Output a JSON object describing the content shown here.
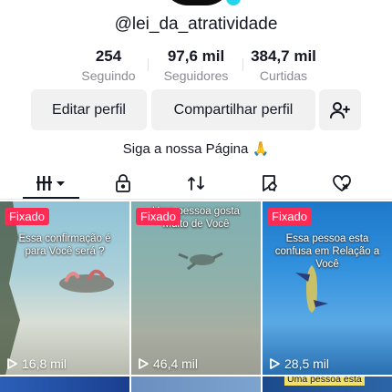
{
  "profile": {
    "username": "@lei_da_atratividade",
    "bio": "Siga a nossa Página 🙏"
  },
  "stats": [
    {
      "value": "254",
      "label": "Seguindo"
    },
    {
      "value": "97,6 mil",
      "label": "Seguidores"
    },
    {
      "value": "384,7 mil",
      "label": "Curtidas"
    }
  ],
  "buttons": {
    "edit": "Editar perfil",
    "share": "Compartilhar perfil"
  },
  "tabs": [
    {
      "icon": "videos-grid-icon",
      "active": true
    },
    {
      "icon": "lock-icon",
      "active": false
    },
    {
      "icon": "repost-icon",
      "active": false
    },
    {
      "icon": "bookmark-hand-icon",
      "active": false
    },
    {
      "icon": "liked-heart-icon",
      "active": false
    }
  ],
  "videos": [
    {
      "pinned": "Fixado",
      "caption": "Essa confirmação é para Você será ?",
      "views": "16,8 mil"
    },
    {
      "pinned": "Fixado",
      "caption": "Uma pessoa gosta Muito de Você",
      "views": "46,4 mil"
    },
    {
      "pinned": "Fixado",
      "caption": "Essa pessoa esta confusa em Relação a Você",
      "views": "28,5 mil"
    },
    {
      "caption": "Uma pessoa está"
    }
  ],
  "colors": {
    "accent": "#fe2c55",
    "text": "#161823",
    "muted": "#8a8b91"
  }
}
